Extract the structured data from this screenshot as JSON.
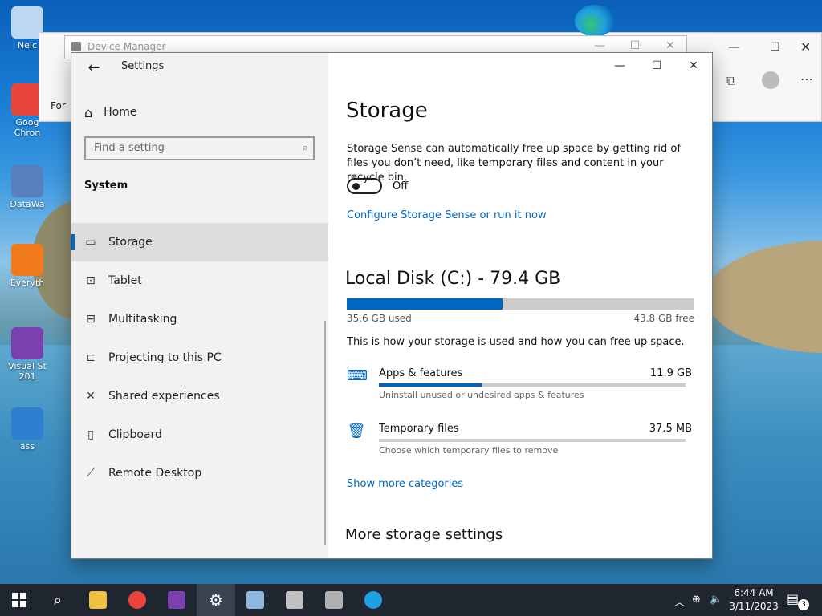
{
  "desktop": {
    "icons": [
      {
        "label": "Neic",
        "icon": "computer-icon",
        "color": "#bcd8f0"
      },
      {
        "label": "Goog\nChron",
        "icon": "chrome-icon",
        "color": "#e8453c"
      },
      {
        "label": "DataWa",
        "icon": "datawarrior-icon",
        "color": "#5a7fbf"
      },
      {
        "label": "Everyth",
        "icon": "everything-search-icon",
        "color": "#f07a1a"
      },
      {
        "label": "Visual St\n201",
        "icon": "visual-studio-icon",
        "color": "#7b3fb0"
      },
      {
        "label": "ass",
        "icon": "app-icon",
        "color": "#2f7fd1"
      }
    ]
  },
  "edge": {
    "partial_tab_text": "For"
  },
  "device_manager": {
    "title": "Device Manager"
  },
  "settings": {
    "app_title": "Settings",
    "home_label": "Home",
    "search_placeholder": "Find a setting",
    "section_title": "System",
    "nav_items": [
      {
        "label": "Storage",
        "icon": "storage-icon",
        "glyph": "▭",
        "active": true
      },
      {
        "label": "Tablet",
        "icon": "tablet-icon",
        "glyph": "⊡",
        "active": false
      },
      {
        "label": "Multitasking",
        "icon": "multitasking-icon",
        "glyph": "⊟",
        "active": false
      },
      {
        "label": "Projecting to this PC",
        "icon": "projecting-icon",
        "glyph": "⊏",
        "active": false
      },
      {
        "label": "Shared experiences",
        "icon": "shared-experiences-icon",
        "glyph": "✕",
        "active": false
      },
      {
        "label": "Clipboard",
        "icon": "clipboard-icon",
        "glyph": "▯",
        "active": false
      },
      {
        "label": "Remote Desktop",
        "icon": "remote-desktop-icon",
        "glyph": "⟋",
        "active": false
      }
    ],
    "main": {
      "title": "Storage",
      "sense_description": "Storage Sense can automatically free up space by getting rid of files you don’t need, like temporary files and content in your recycle bin.",
      "toggle_state": "Off",
      "configure_link": "Configure Storage Sense or run it now",
      "disk_title": "Local Disk (C:) - 79.4 GB",
      "used_label": "35.6 GB used",
      "free_label": "43.8 GB free",
      "used_fraction": 0.448,
      "info_text": "This is how your storage is used and how you can free up space.",
      "categories": [
        {
          "name": "Apps & features",
          "size": "11.9 GB",
          "subtitle": "Uninstall unused or undesired apps & features",
          "icon": "keyboard-icon",
          "fraction": 0.335
        },
        {
          "name": "Temporary files",
          "size": "37.5 MB",
          "subtitle": "Choose which temporary files to remove",
          "icon": "trash-icon",
          "fraction": 0.0
        }
      ],
      "more_categories_link": "Show more categories",
      "more_settings_title": "More storage settings"
    }
  },
  "taskbar": {
    "apps": [
      {
        "icon": "file-explorer-icon",
        "color": "#f0c040"
      },
      {
        "icon": "chrome-icon",
        "color": "#e8453c"
      },
      {
        "icon": "visual-studio-icon",
        "color": "#7b3fb0"
      },
      {
        "icon": "settings-gear-icon",
        "color": "#ffffff",
        "active": true
      },
      {
        "icon": "remote-desktop-app-icon",
        "color": "#8fb8e0"
      },
      {
        "icon": "performance-monitor-icon",
        "color": "#c0c0c0"
      },
      {
        "icon": "network-app-icon",
        "color": "#b0b0b0"
      },
      {
        "icon": "edge-icon",
        "color": "#1fa0e0"
      }
    ],
    "time": "6:44 AM",
    "date": "3/11/2023",
    "notification_count": "3"
  }
}
